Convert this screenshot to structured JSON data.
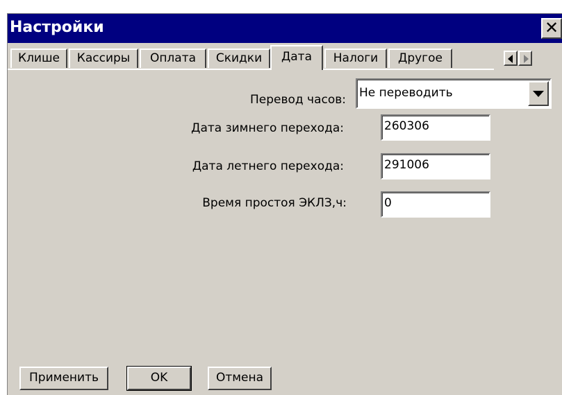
{
  "window": {
    "title": "Настройки",
    "close_glyph": "✕"
  },
  "tabs": [
    {
      "label": "Клише"
    },
    {
      "label": "Кассиры"
    },
    {
      "label": "Оплата"
    },
    {
      "label": "Скидки"
    },
    {
      "label": "Дата",
      "active": true
    },
    {
      "label": "Налоги"
    },
    {
      "label": "Другое"
    }
  ],
  "form": {
    "clock_change_label": "Перевод часов:",
    "clock_change_value": "Не переводить",
    "winter_date_label": "Дата зимнего перехода:",
    "winter_date_value": "260306",
    "summer_date_label": "Дата летнего перехода:",
    "summer_date_value": "291006",
    "idle_time_label": "Время простоя ЭКЛЗ,ч:",
    "idle_time_value": "0"
  },
  "buttons": {
    "apply_label": "Применить",
    "ok_label": "OK",
    "cancel_label": "Отмена"
  },
  "colors": {
    "titlebar": "#000080",
    "window_bg": "#d4d0c8"
  }
}
